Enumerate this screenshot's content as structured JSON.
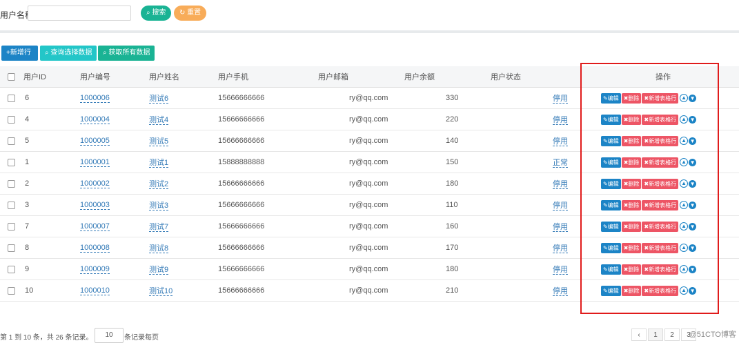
{
  "search": {
    "label": "用户名称:",
    "input_value": "",
    "search_btn": "搜索",
    "reset_btn": "重置"
  },
  "toolbar": {
    "add": "+新增行",
    "query_selected": "查询选择数据",
    "get_all": "获取所有数据"
  },
  "table": {
    "columns": [
      "用户ID",
      "用户编号",
      "用户姓名",
      "用户手机",
      "用户邮箱",
      "用户余额",
      "用户状态",
      "操作"
    ],
    "rows": [
      {
        "id": "6",
        "code": "1000006",
        "name": "测试6",
        "phone": "15666666666",
        "email": "ry@qq.com",
        "balance": "330",
        "status": "停用"
      },
      {
        "id": "4",
        "code": "1000004",
        "name": "测试4",
        "phone": "15666666666",
        "email": "ry@qq.com",
        "balance": "220",
        "status": "停用"
      },
      {
        "id": "5",
        "code": "1000005",
        "name": "测试5",
        "phone": "15666666666",
        "email": "ry@qq.com",
        "balance": "140",
        "status": "停用"
      },
      {
        "id": "1",
        "code": "1000001",
        "name": "测试1",
        "phone": "15888888888",
        "email": "ry@qq.com",
        "balance": "150",
        "status": "正常"
      },
      {
        "id": "2",
        "code": "1000002",
        "name": "测试2",
        "phone": "15666666666",
        "email": "ry@qq.com",
        "balance": "180",
        "status": "停用"
      },
      {
        "id": "3",
        "code": "1000003",
        "name": "测试3",
        "phone": "15666666666",
        "email": "ry@qq.com",
        "balance": "110",
        "status": "停用"
      },
      {
        "id": "7",
        "code": "1000007",
        "name": "测试7",
        "phone": "15666666666",
        "email": "ry@qq.com",
        "balance": "160",
        "status": "停用"
      },
      {
        "id": "8",
        "code": "1000008",
        "name": "测试8",
        "phone": "15666666666",
        "email": "ry@qq.com",
        "balance": "170",
        "status": "停用"
      },
      {
        "id": "9",
        "code": "1000009",
        "name": "测试9",
        "phone": "15666666666",
        "email": "ry@qq.com",
        "balance": "180",
        "status": "停用"
      },
      {
        "id": "10",
        "code": "1000010",
        "name": "测试10",
        "phone": "15666666666",
        "email": "ry@qq.com",
        "balance": "210",
        "status": "停用"
      }
    ],
    "action_labels": {
      "edit": "编辑",
      "delete": "删除",
      "add_row": "新增表格行"
    }
  },
  "footer": {
    "info": "第 1 到 10 条，共 26 条记录。",
    "page_size": "10",
    "per_page_label": "条记录每页",
    "pages": [
      "‹",
      "1",
      "2",
      "3"
    ]
  },
  "watermark": "@51CTO博客",
  "colors": {
    "primary": "#1c84c6",
    "success": "#1ab394",
    "info": "#23c6c8",
    "warning": "#f8ac59",
    "danger": "#ed5565",
    "highlight_box": "#e01b1b"
  }
}
